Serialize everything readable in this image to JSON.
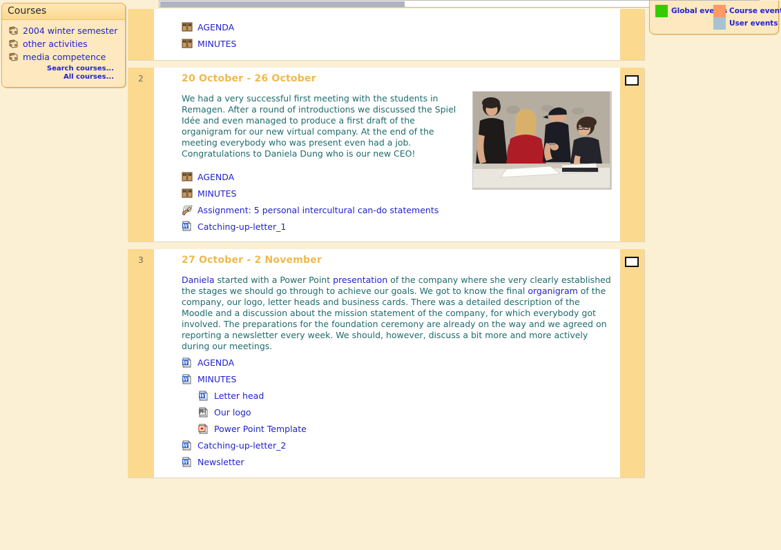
{
  "page": {
    "background_color": "#fbefd4",
    "section_band_color": "#fbd98e",
    "content_color": "#ffffff",
    "link_color": "#2222cc",
    "summary_text_color": "#1f6b6b",
    "section_title_color": "#f0b94e"
  },
  "scrollbar": {
    "name": "horizontal-scrollbar",
    "orientation": "horizontal",
    "thumb_position_percent": 0,
    "thumb_width_percent": 41
  },
  "courses_block": {
    "title": "Courses",
    "items": [
      {
        "label": "2004 winter semester",
        "icon": "course-icon"
      },
      {
        "label": "other activities",
        "icon": "course-icon"
      },
      {
        "label": "media competence",
        "icon": "course-icon"
      }
    ],
    "links": [
      {
        "label": "Search courses..."
      },
      {
        "label": "All courses..."
      }
    ]
  },
  "events_legend": {
    "items": [
      {
        "label": "Global events",
        "color": "#33cc00"
      },
      {
        "label": "Course events",
        "color": "#ff9966"
      },
      {
        "label": "User events",
        "color": "#a8c2d4"
      }
    ]
  },
  "sections": [
    {
      "number": "",
      "title": "",
      "summary_html": "",
      "clipped": true,
      "has_highlight_marker": false,
      "activities": [
        {
          "label": "AGENDA",
          "icon": "wiki-icon",
          "indent": false
        },
        {
          "label": "MINUTES",
          "icon": "wiki-icon",
          "indent": false
        }
      ]
    },
    {
      "number": "2",
      "title": "20 October - 26 October",
      "summary_html": "We had a very successful first meeting with the students in Remagen. After a round of introductions we discussed the Spiel Id&eacute;e and even managed to produce a first draft of the organigram for our new virtual company. At the end of the meeting everybody who was present even had a job. Congratulations to Daniela Dung who is our new CEO!",
      "clipped": false,
      "has_highlight_marker": true,
      "photo": {
        "name": "students-meeting-photo",
        "alt": "Four students standing and sitting around a table with papers, smiling"
      },
      "activities": [
        {
          "label": "AGENDA",
          "icon": "wiki-icon",
          "indent": false
        },
        {
          "label": "MINUTES",
          "icon": "wiki-icon",
          "indent": false
        },
        {
          "label": "Assignment: 5 personal intercultural can-do statements",
          "icon": "assignment-icon",
          "indent": false
        },
        {
          "label": "Catching-up-letter_1",
          "icon": "word-doc-icon",
          "indent": false
        }
      ]
    },
    {
      "number": "3",
      "title": "27 October - 2 November",
      "summary_html": "<a href=\"#\">Daniela</a> started with a Power Point <a href=\"#\">presentation</a> of the company where she very clearly established the stages we should go through to achieve our goals. We got to know the final <a href=\"#\">organigram</a> of the company, our logo, letter heads and business cards. There was a detailed description of the Moodle and a discussion about the mission statement of the company, for which everybody got involved. The preparations for the foundation ceremony are already on the way and we agreed on reporting a newsletter every week. We should, however, discuss a bit more and more actively during our meetings.",
      "clipped": false,
      "has_highlight_marker": true,
      "activities": [
        {
          "label": "AGENDA",
          "icon": "word-doc-icon",
          "indent": false
        },
        {
          "label": "MINUTES",
          "icon": "word-doc-icon",
          "indent": false
        },
        {
          "label": "Letter head",
          "icon": "word-doc-icon",
          "indent": true
        },
        {
          "label": "Our logo",
          "icon": "image-file-icon",
          "indent": true
        },
        {
          "label": "Power Point Template",
          "icon": "powerpoint-icon",
          "indent": true
        },
        {
          "label": "Catching-up-letter_2",
          "icon": "word-doc-icon",
          "indent": false
        },
        {
          "label": "Newsletter",
          "icon": "word-doc-icon",
          "indent": false
        }
      ]
    }
  ]
}
